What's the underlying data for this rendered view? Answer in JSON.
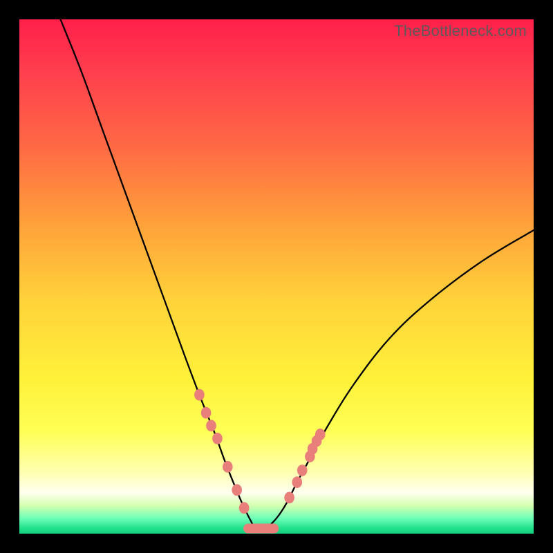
{
  "watermark": "TheBottleneck.com",
  "chart_data": {
    "type": "line",
    "title": "",
    "xlabel": "",
    "ylabel": "",
    "xlim": [
      0,
      100
    ],
    "ylim": [
      0,
      100
    ],
    "grid": false,
    "legend": false,
    "description": "V-shaped bottleneck curve on rainbow gradient; minimum near x≈46. Coral dots mark sample points along the curve near the trough; a short flat coral segment marks the bottom.",
    "series": [
      {
        "name": "bottleneck-curve",
        "x": [
          8,
          12,
          16,
          20,
          24,
          28,
          32,
          35,
          38,
          40,
          42,
          43.5,
          45,
          46,
          48,
          50,
          52,
          54,
          57,
          60,
          65,
          72,
          80,
          90,
          100
        ],
        "y": [
          100,
          90,
          79,
          68,
          57,
          46,
          35,
          27,
          19.5,
          14,
          9,
          5.5,
          2.5,
          1,
          1.2,
          3,
          6,
          10,
          15.5,
          21,
          29,
          38,
          45.5,
          53,
          59
        ]
      }
    ],
    "markers_left": [
      {
        "x": 35.0,
        "y": 27.0
      },
      {
        "x": 36.3,
        "y": 23.5
      },
      {
        "x": 37.3,
        "y": 21.0
      },
      {
        "x": 38.5,
        "y": 18.5
      },
      {
        "x": 40.5,
        "y": 13.0
      },
      {
        "x": 42.3,
        "y": 8.5
      },
      {
        "x": 43.7,
        "y": 5.0
      }
    ],
    "markers_right": [
      {
        "x": 52.5,
        "y": 7.0
      },
      {
        "x": 54.0,
        "y": 10.0
      },
      {
        "x": 55.0,
        "y": 12.3
      },
      {
        "x": 56.5,
        "y": 15.0
      },
      {
        "x": 57.0,
        "y": 16.5
      },
      {
        "x": 57.8,
        "y": 18.0
      },
      {
        "x": 58.5,
        "y": 19.3
      }
    ],
    "flat_segment": {
      "x0": 44.5,
      "x1": 49.5,
      "y": 1.0
    }
  }
}
